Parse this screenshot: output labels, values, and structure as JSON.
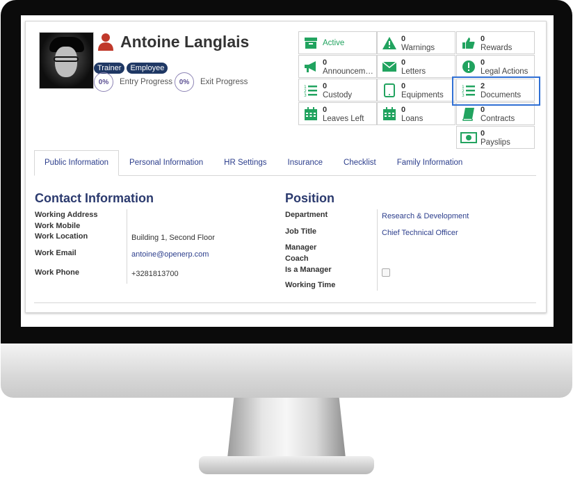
{
  "employee": {
    "name": "Antoine Langlais",
    "tags": [
      "Trainer",
      "Employee"
    ],
    "entry_progress": "0%",
    "entry_label": "Entry Progress",
    "exit_progress": "0%",
    "exit_label": "Exit Progress"
  },
  "smart_buttons": [
    {
      "label": "Active",
      "value": "",
      "icon": "archive-icon",
      "color": "#21a35f"
    },
    {
      "label": "Warnings",
      "value": "0",
      "icon": "warning-icon",
      "color": "#21a35f"
    },
    {
      "label": "Rewards",
      "value": "0",
      "icon": "thumbs-up-icon",
      "color": "#21a35f"
    },
    {
      "label": "Announceme...",
      "value": "0",
      "icon": "bullhorn-icon",
      "color": "#21a35f"
    },
    {
      "label": "Letters",
      "value": "0",
      "icon": "envelope-icon",
      "color": "#21a35f"
    },
    {
      "label": "Legal Actions",
      "value": "0",
      "icon": "exclamation-icon",
      "color": "#21a35f"
    },
    {
      "label": "Custody",
      "value": "0",
      "icon": "list-ol-icon",
      "color": "#21a35f"
    },
    {
      "label": "Equipments",
      "value": "0",
      "icon": "tablet-icon",
      "color": "#21a35f"
    },
    {
      "label": "Documents",
      "value": "2",
      "icon": "list-ol-icon",
      "color": "#21a35f"
    },
    {
      "label": "Leaves Left",
      "value": "0",
      "icon": "calendar-icon",
      "color": "#21a35f"
    },
    {
      "label": "Loans",
      "value": "0",
      "icon": "calendar-icon",
      "color": "#21a35f"
    },
    {
      "label": "Contracts",
      "value": "0",
      "icon": "book-icon",
      "color": "#21a35f"
    },
    {
      "label": "Payslips",
      "value": "0",
      "icon": "money-icon",
      "color": "#21a35f"
    }
  ],
  "tabs": [
    "Public Information",
    "Personal Information",
    "HR Settings",
    "Insurance",
    "Checklist",
    "Family Information"
  ],
  "contact": {
    "title": "Contact Information",
    "working_address_label": "Working Address",
    "work_mobile_label": "Work Mobile",
    "work_location_label": "Work Location",
    "work_location": "Building 1, Second Floor",
    "work_email_label": "Work Email",
    "work_email": "antoine@openerp.com",
    "work_phone_label": "Work Phone",
    "work_phone": "+3281813700"
  },
  "position": {
    "title": "Position",
    "department_label": "Department",
    "department": "Research & Development",
    "job_title_label": "Job Title",
    "job_title": "Chief Technical Officer",
    "manager_label": "Manager",
    "coach_label": "Coach",
    "is_manager_label": "Is a Manager",
    "working_time_label": "Working Time"
  },
  "colors": {
    "accent": "#21a35f",
    "highlight": "#2f6fd4",
    "tag": "#1f3864",
    "link": "#2c3e8c"
  }
}
